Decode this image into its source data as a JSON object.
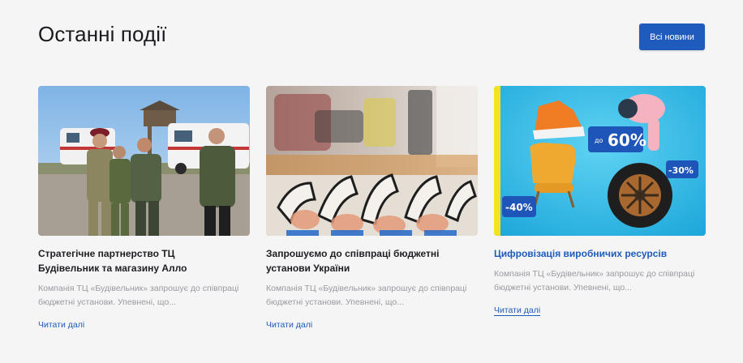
{
  "section": {
    "title": "Останні події",
    "all_news_label": "Всі новини"
  },
  "cards": [
    {
      "title": "Стратегічне партнерство  ТЦ Будівельник та магазину Алло",
      "description": "Компанія ТЦ «Будівельник» запрошує до співпраці бюджетні установи. Упевнені, що...",
      "read_more": "Читати далі"
    },
    {
      "title": "Запрошуємо до співпраці бюджетні установи України",
      "description": "Компанія ТЦ «Будівельник» запрошує до співпраці бюджетні установи. Упевнені, що...",
      "read_more": "Читати далі"
    },
    {
      "title": "Цифровізація виробничих ресурсів",
      "description": "Компанія ТЦ «Будівельник» запрошує до співпраці бюджетні установи. Упевнені, що...",
      "read_more": "Читати далі",
      "promo": {
        "badge_60": "60%",
        "badge_60_prefix": "до",
        "badge_40": "-40%",
        "badge_30": "-30%"
      }
    }
  ],
  "colors": {
    "accent": "#1f5bbd",
    "background": "#f5f5f6",
    "muted_text": "#9a9aa0"
  }
}
